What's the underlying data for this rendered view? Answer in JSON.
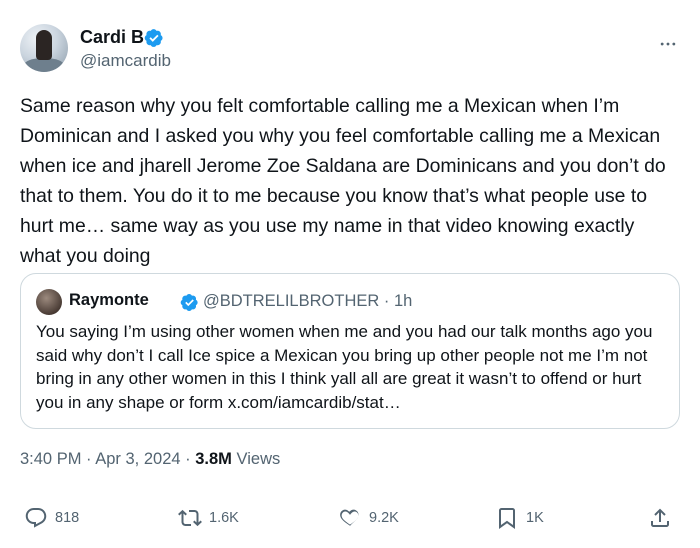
{
  "tweet": {
    "author": {
      "name": "Cardi B",
      "handle": "@iamcardib",
      "verified": true
    },
    "text": "Same reason why you felt comfortable calling me a Mexican when I’m Dominican and I asked you why you feel comfortable calling me a Mexican when ice and jharell Jerome Zoe Saldana are Dominicans and you don’t do that to them. You do it to me because you know that’s what people use to hurt me… same way as you use my name in that video knowing exactly what you doing",
    "quote": {
      "name": "Raymonte",
      "handle": "@BDTRELILBROTHER",
      "separator": "·",
      "time": "1h",
      "text": "You saying I’m using other women when me and you had our talk months ago you said why don’t I call Ice spice a Mexican you bring up other people not me I’m not bring in any other women in this I think yall all are great it wasn’t to offend or hurt you in any shape or form x.com/iamcardib/stat…"
    },
    "meta": {
      "time": "3:40 PM",
      "dot1": "·",
      "date": "Apr 3, 2024",
      "dot2": "·",
      "views_count": "3.8M",
      "views_label": "Views"
    },
    "actions": {
      "replies": "818",
      "reposts": "1.6K",
      "likes": "9.2K",
      "bookmarks": "1K"
    }
  },
  "colors": {
    "verified_blue": "#1d9bf0",
    "text_primary": "#0f1419",
    "text_secondary": "#536471",
    "border": "#cfd9de"
  },
  "icons": [
    "more-icon",
    "verified-badge-icon",
    "reply-icon",
    "repost-icon",
    "like-icon",
    "bookmark-icon",
    "share-icon"
  ]
}
